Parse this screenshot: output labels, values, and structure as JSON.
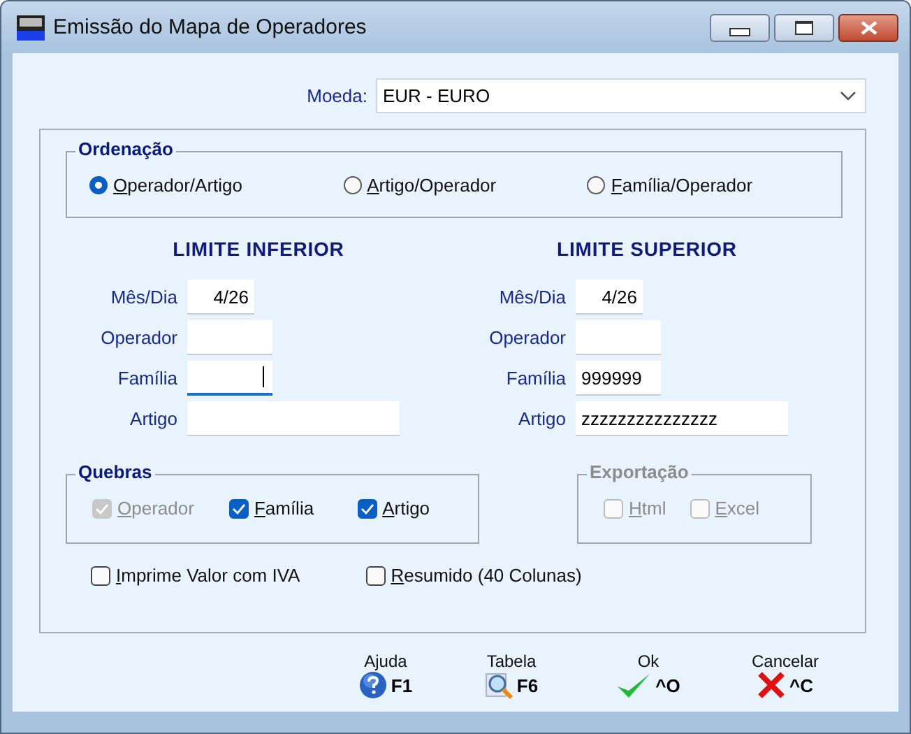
{
  "window": {
    "title": "Emissão do Mapa de Operadores"
  },
  "currency": {
    "label": "Moeda:",
    "value": "EUR - EURO"
  },
  "ordering": {
    "title": "Ordenação",
    "options": [
      {
        "label": "Operador/Artigo",
        "selected": true
      },
      {
        "label": "Artigo/Operador",
        "selected": false
      },
      {
        "label": "Família/Operador",
        "selected": false
      }
    ]
  },
  "limits": [
    {
      "heading": "LIMITE INFERIOR",
      "fields": [
        {
          "label": "Mês/Dia",
          "value": "4/26",
          "kind": "date",
          "focused": false
        },
        {
          "label": "Operador",
          "kind": "code",
          "focused": false
        },
        {
          "label": "Família",
          "kind": "code",
          "focused": true
        },
        {
          "label": "Artigo",
          "kind": "text",
          "focused": false
        }
      ]
    },
    {
      "heading": "LIMITE SUPERIOR",
      "fields": [
        {
          "label": "Mês/Dia",
          "value": "4/26",
          "kind": "date",
          "focused": false
        },
        {
          "label": "Operador",
          "kind": "code",
          "focused": false
        },
        {
          "label": "Família",
          "value": "999999",
          "kind": "code",
          "focused": false
        },
        {
          "label": "Artigo",
          "value": "zzzzzzzzzzzzzzz",
          "kind": "text",
          "focused": false
        }
      ]
    }
  ],
  "breaks": {
    "title": "Quebras",
    "disabled": false,
    "items": [
      {
        "label": "Operador",
        "checked": true,
        "disabled": true
      },
      {
        "label": "Família",
        "checked": true,
        "disabled": false
      },
      {
        "label": "Artigo",
        "checked": true,
        "disabled": false
      }
    ]
  },
  "export": {
    "title": "Exportação",
    "disabled": true,
    "items": [
      {
        "label": "Html",
        "checked": false,
        "disabled": true
      },
      {
        "label": "Excel",
        "checked": false,
        "disabled": true
      }
    ]
  },
  "options": [
    {
      "label": "Imprime Valor com IVA",
      "checked": false
    },
    {
      "label": "Resumido (40 Colunas)",
      "checked": false
    }
  ],
  "buttons": [
    {
      "label": "Ajuda",
      "key": "F1",
      "kind": "help"
    },
    {
      "label": "Tabela",
      "key": "F6",
      "kind": "search"
    },
    {
      "label": "Ok",
      "key": "^O",
      "kind": "ok"
    },
    {
      "label": "Cancelar",
      "key": "^C",
      "kind": "cancel"
    }
  ]
}
